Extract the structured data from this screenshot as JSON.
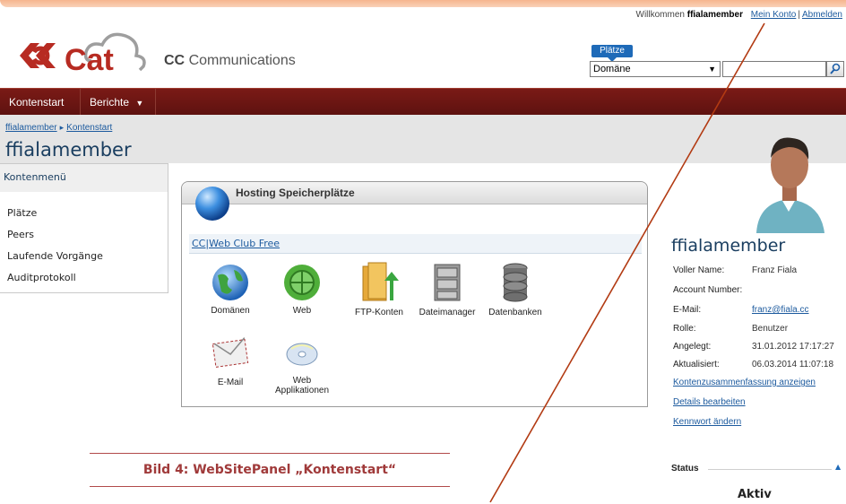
{
  "header": {
    "welcome_text": "Willkommen",
    "username": "ffialamember",
    "my_account": "Mein Konto",
    "separator": "|",
    "logout": "Abmelden",
    "brand_cc": "CC",
    "brand_rest": "Communications",
    "logo_text": "Cat"
  },
  "search": {
    "scope_badge": "Plätze",
    "scope_value": "Domäne",
    "query": ""
  },
  "nav": {
    "items": [
      {
        "label": "Kontenstart"
      },
      {
        "label": "Berichte"
      }
    ]
  },
  "breadcrumb": {
    "items": [
      "ffialamember",
      "Kontenstart"
    ]
  },
  "page_title": "ffialamember",
  "side_menu": {
    "title": "Kontenmenü",
    "items": [
      "Plätze",
      "Peers",
      "Laufende Vorgänge",
      "Auditprotokoll"
    ]
  },
  "panel": {
    "title": "Hosting Speicherplätze",
    "plan": "CC|Web Club Free",
    "tiles": [
      {
        "label": "Domänen",
        "icon": "globe-icon"
      },
      {
        "label": "Web",
        "icon": "web-globe-icon"
      },
      {
        "label": "FTP-Konten",
        "icon": "ftp-folder-icon"
      },
      {
        "label": "Dateimanager",
        "icon": "file-cabinet-icon"
      },
      {
        "label": "Datenbanken",
        "icon": "database-icon"
      },
      {
        "label": "E-Mail",
        "icon": "envelope-icon"
      },
      {
        "label": "Web Applikationen",
        "icon": "cd-icon"
      }
    ]
  },
  "caption": "Bild 4: WebSitePanel „Kontenstart“",
  "profile": {
    "name": "ffialamember",
    "rows": [
      {
        "label": "Voller Name:",
        "value": "Franz Fiala"
      },
      {
        "label": "Account Number:",
        "value": ""
      },
      {
        "label": "E-Mail:",
        "value": "franz@fiala.cc"
      },
      {
        "label": "Rolle:",
        "value": "Benutzer"
      },
      {
        "label": "Angelegt:",
        "value": "31.01.2012 17:17:27"
      },
      {
        "label": "Aktualisiert:",
        "value": "06.03.2014 11:07:18"
      }
    ],
    "links": [
      "Kontenzusammenfassung anzeigen",
      "Details bearbeiten",
      "Kennwort ändern"
    ],
    "status_label": "Status",
    "status_value": "Aktiv"
  },
  "colors": {
    "nav": "#6b1512",
    "link": "#1c5a9e",
    "title": "#1a3e60",
    "caption": "#a03a3a",
    "annotation_line": "#b23a12"
  }
}
